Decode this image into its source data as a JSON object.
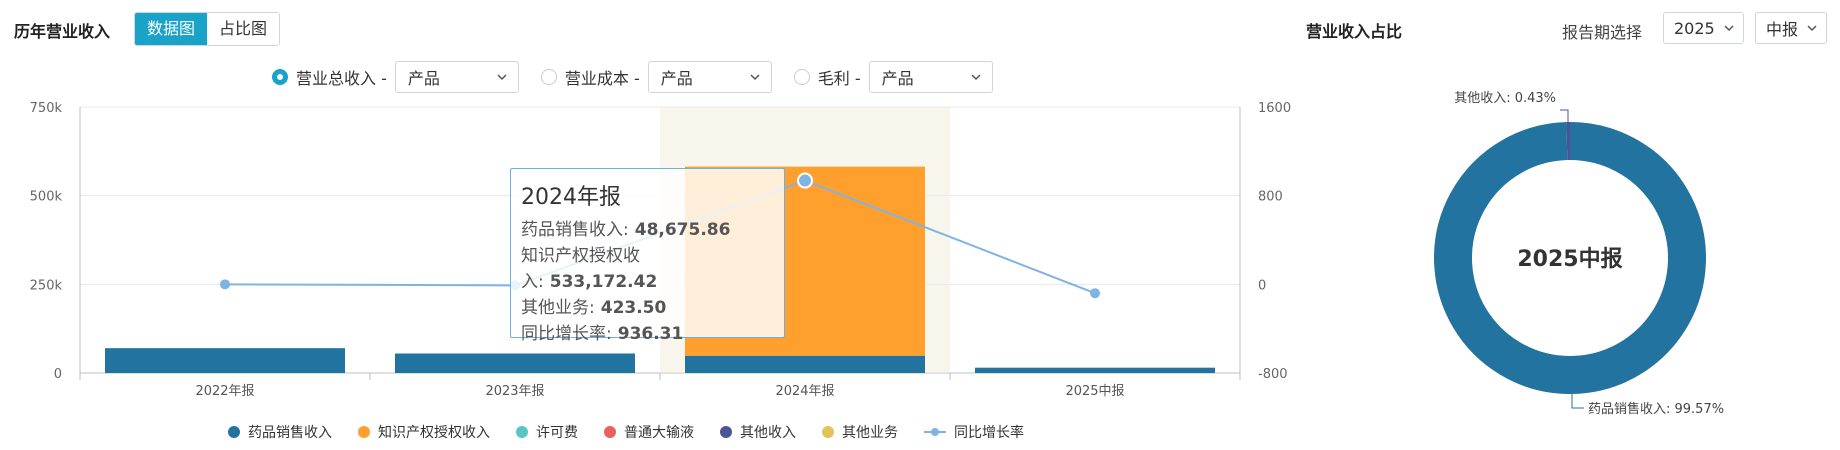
{
  "header": {
    "title": "历年营业收入",
    "tabs": [
      {
        "label": "数据图",
        "active": true
      },
      {
        "label": "占比图",
        "active": false
      }
    ]
  },
  "filters": [
    {
      "label": "营业总收入 -",
      "checked": true,
      "select": "产品"
    },
    {
      "label": "营业成本 -",
      "checked": false,
      "select": "产品"
    },
    {
      "label": "毛利 -",
      "checked": false,
      "select": "产品"
    }
  ],
  "right_header": {
    "title": "营业收入占比",
    "period_label": "报告期选择",
    "year_select": "2025",
    "period_select": "中报"
  },
  "tooltip": {
    "title": "2024年报",
    "rows": [
      {
        "label": "药品销售收入:",
        "value": "48,675.86"
      },
      {
        "label": "知识产权授权收入:",
        "value": "533,172.42"
      },
      {
        "label": "其他业务:",
        "value": "423.50"
      },
      {
        "label": "同比增长率:",
        "value": "936.31"
      }
    ]
  },
  "colors": {
    "drug_sales": "#22739f",
    "ip_license": "#ff9f2e",
    "license_fee": "#5bc4c4",
    "infusion": "#e8615e",
    "other_income": "#4a5497",
    "other_business": "#e2c35a",
    "growth_line": "#7fb4e2",
    "accent": "#1aa3c9"
  },
  "chart_data": [
    {
      "type": "bar",
      "stacked": true,
      "categories": [
        "2022年报",
        "2023年报",
        "2024年报",
        "2025中报"
      ],
      "series": [
        {
          "name": "药品销售收入",
          "values": [
            70000,
            55000,
            48675.86,
            15000
          ]
        },
        {
          "name": "知识产权授权收入",
          "values": [
            0,
            0,
            533172.42,
            0
          ]
        },
        {
          "name": "许可费",
          "values": [
            0,
            0,
            0,
            0
          ]
        },
        {
          "name": "普通大输液",
          "values": [
            0,
            0,
            0,
            0
          ]
        },
        {
          "name": "其他收入",
          "values": [
            0,
            0,
            0,
            0
          ]
        },
        {
          "name": "其他业务",
          "values": [
            0,
            0,
            423.5,
            0
          ]
        }
      ],
      "line_series": {
        "name": "同比增长率",
        "values": [
          0,
          -10,
          936.31,
          -80
        ],
        "axis": "right"
      },
      "y_left": {
        "ticks": [
          "0",
          "250k",
          "500k",
          "750k"
        ],
        "ylim": [
          0,
          750000
        ]
      },
      "y_right": {
        "ticks": [
          "-800",
          "0",
          "800",
          "1600"
        ],
        "ylim": [
          -800,
          1600
        ]
      },
      "legend": [
        "药品销售收入",
        "知识产权授权收入",
        "许可费",
        "普通大输液",
        "其他收入",
        "其他业务",
        "同比增长率"
      ],
      "legend_position": "bottom",
      "grid": true
    },
    {
      "type": "pie",
      "donut": true,
      "center_label": "2025中报",
      "slices": [
        {
          "name": "药品销售收入",
          "value": 99.57,
          "label": "药品销售收入: 99.57%"
        },
        {
          "name": "其他收入",
          "value": 0.43,
          "label": "其他收入: 0.43%"
        }
      ]
    }
  ]
}
